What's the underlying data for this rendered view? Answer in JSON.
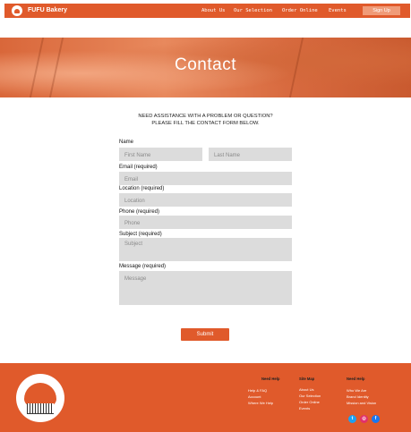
{
  "nav": {
    "brand": "FUFU Bakery",
    "links": [
      "About Us",
      "Our Selection",
      "Order Online",
      "Events"
    ],
    "signup": "Sign Up"
  },
  "hero": {
    "title": "Contact"
  },
  "intro": {
    "line1": "NEED ASSISTANCE WITH A PROBLEM OR QUESTION?",
    "line2": "PLEASE FILL THE CONTACT FORM BELOW."
  },
  "form": {
    "name_label": "Name",
    "first_name_placeholder": "First Name",
    "last_name_placeholder": "Last Name",
    "email_label": "Email (required)",
    "email_placeholder": "Email",
    "location_label": "Location (required)",
    "location_placeholder": "Location",
    "phone_label": "Phone (required)",
    "phone_placeholder": "Phone",
    "subject_label": "Subject (required)",
    "subject_placeholder": "Subject",
    "message_label": "Message (required)",
    "message_placeholder": "Message",
    "submit": "Submit"
  },
  "footer": {
    "columns": [
      {
        "heading": "Need Help",
        "links": [
          "Help & FAQ",
          "Account",
          "Where We Help"
        ]
      },
      {
        "heading": "Site Map",
        "links": [
          "About Us",
          "Our Selection",
          "Order Online",
          "Events"
        ]
      },
      {
        "heading": "Need Help",
        "links": [
          "Who We Are",
          "Brand Identity",
          "Mission and Vision"
        ]
      }
    ],
    "social": [
      {
        "icon": "twitter-icon",
        "glyph": "t",
        "color": "#1da1f2"
      },
      {
        "icon": "instagram-icon",
        "glyph": "◎",
        "color": "#e1306c"
      },
      {
        "icon": "facebook-icon",
        "glyph": "f",
        "color": "#1877f2"
      }
    ]
  },
  "colors": {
    "brand": "#e05a2b",
    "signup": "#f09b78",
    "field": "#dcdcdc"
  }
}
